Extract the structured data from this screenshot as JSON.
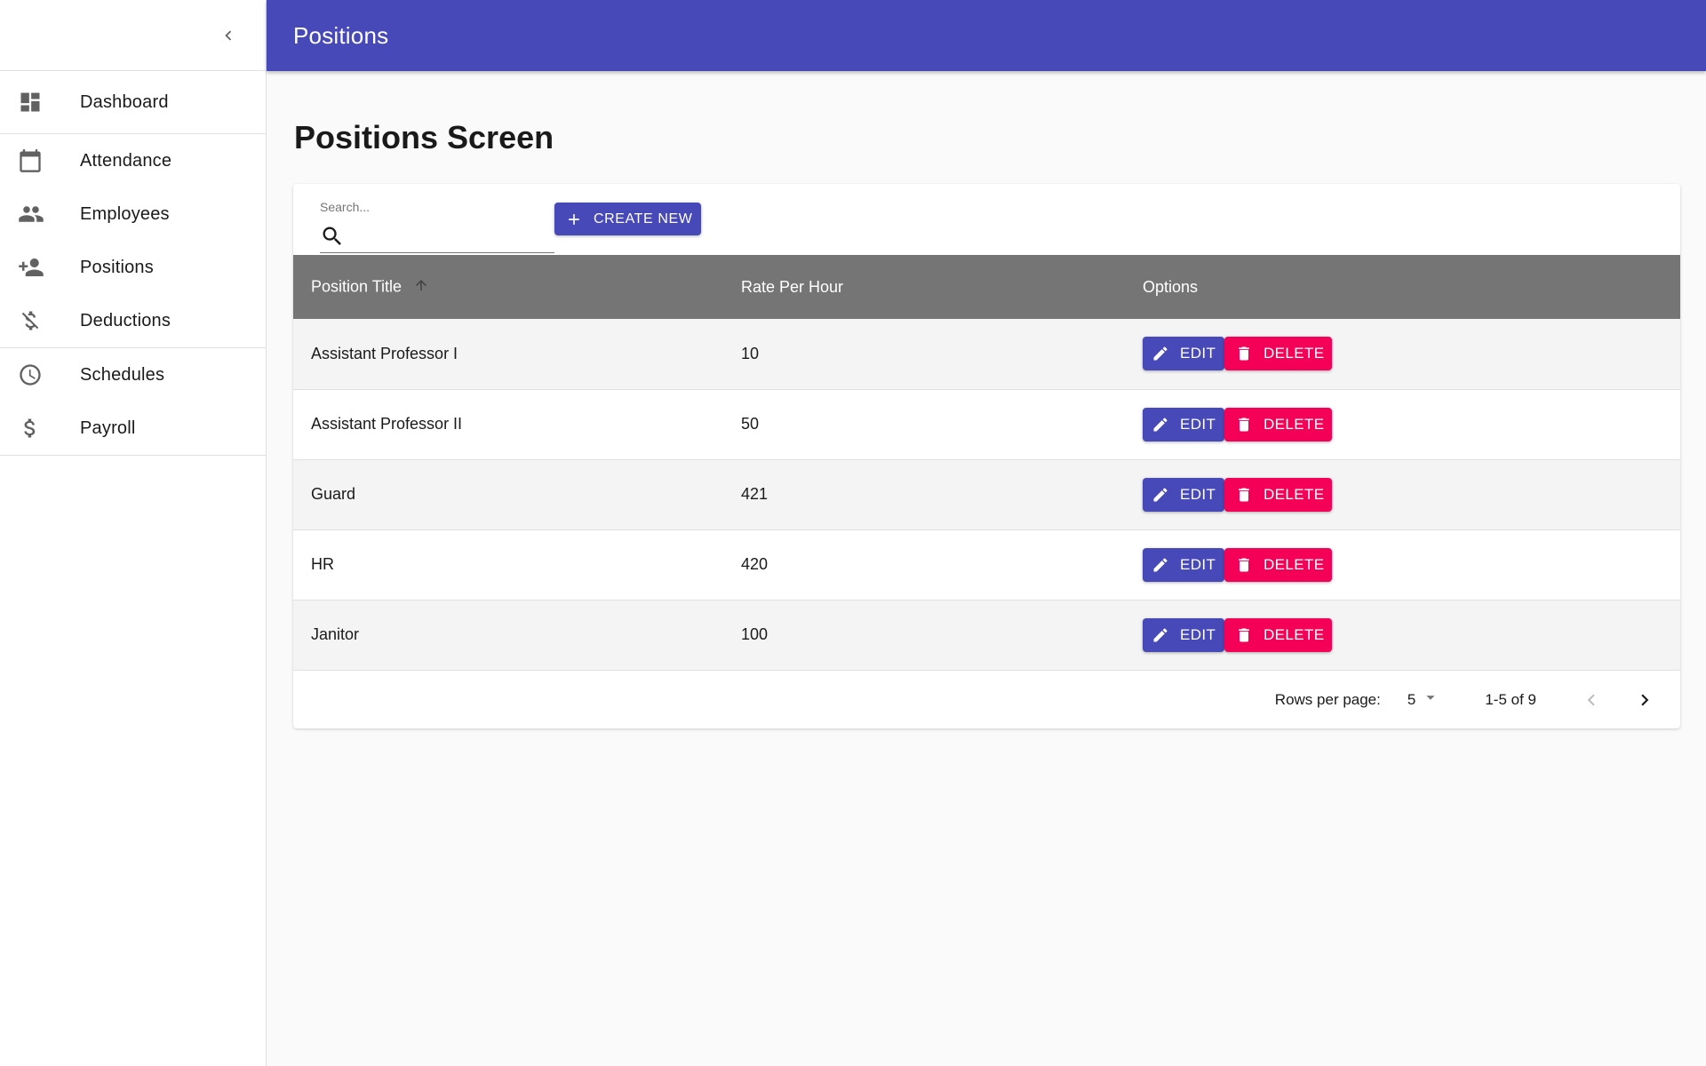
{
  "app": {
    "header_title": "Positions"
  },
  "sidebar": {
    "collapse_icon": "chevron-left-icon",
    "items": [
      {
        "label": "Dashboard",
        "icon": "dashboard-icon"
      },
      {
        "label": "Attendance",
        "icon": "calendar-icon"
      },
      {
        "label": "Employees",
        "icon": "people-icon"
      },
      {
        "label": "Positions",
        "icon": "person-add-icon"
      },
      {
        "label": "Deductions",
        "icon": "money-off-icon"
      },
      {
        "label": "Schedules",
        "icon": "clock-icon"
      },
      {
        "label": "Payroll",
        "icon": "dollar-icon"
      }
    ]
  },
  "main": {
    "title": "Positions Screen",
    "search": {
      "placeholder": "Search...",
      "value": ""
    },
    "create_button": "CREATE NEW",
    "table": {
      "columns": [
        "Position Title",
        "Rate Per Hour",
        "Options"
      ],
      "sort_column": "Position Title",
      "sort_direction": "ascending",
      "rows": [
        {
          "title": "Assistant Professor I",
          "rate": "10"
        },
        {
          "title": "Assistant Professor II",
          "rate": "50"
        },
        {
          "title": "Guard",
          "rate": "421"
        },
        {
          "title": "HR",
          "rate": "420"
        },
        {
          "title": "Janitor",
          "rate": "100"
        }
      ],
      "edit_label": "EDIT",
      "delete_label": "DELETE"
    },
    "pagination": {
      "rows_per_page_label": "Rows per page:",
      "rows_per_page_value": "5",
      "range_text": "1-5 of 9"
    }
  },
  "colors": {
    "primary": "#4649b7",
    "danger": "#f50057",
    "table_header": "#757575"
  }
}
